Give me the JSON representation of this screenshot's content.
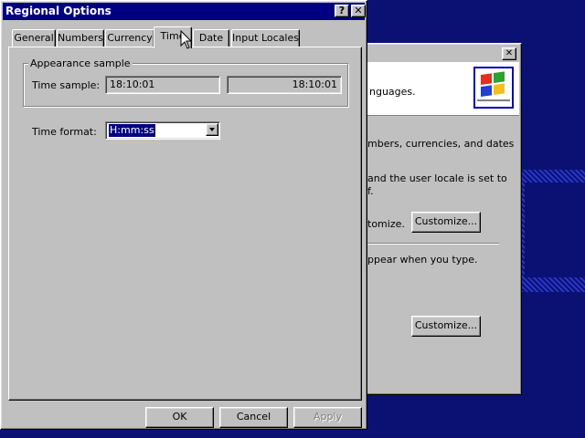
{
  "main_dialog": {
    "title": "Regional Options",
    "help_label": "?",
    "close_label": "✕",
    "tabs": [
      {
        "label": "General"
      },
      {
        "label": "Numbers"
      },
      {
        "label": "Currency"
      },
      {
        "label": "Time"
      },
      {
        "label": "Date"
      },
      {
        "label": "Input Locales"
      }
    ],
    "active_tab": "Time",
    "appearance": {
      "group_label": "Appearance sample",
      "time_sample_label": "Time sample:",
      "time_sample_value": "18:10:01",
      "time_sample_value_2": "18:10:01"
    },
    "time_format": {
      "label": "Time format:",
      "value": "H:mm:ss"
    },
    "buttons": {
      "ok": "OK",
      "cancel": "Cancel",
      "apply": "Apply"
    }
  },
  "background_dialog": {
    "close_label": "✕",
    "header_text": "nguages.",
    "line1": "mbers, currencies, and dates",
    "line2a": "and the user locale is set to",
    "line2b": "f.",
    "line3": "tomize.",
    "customize_label_1": "Customize...",
    "line4": "ppear when you type.",
    "customize_label_2": "Customize..."
  },
  "colors": {
    "desktop": "#0a1172",
    "titlebar_active": "#000080",
    "face": "#c0c0c0",
    "selection": "#000080"
  },
  "icons": {
    "cursor": "arrow-cursor-icon",
    "flag": "windows-flag-icon",
    "dropdown": "dropdown-arrow-icon"
  }
}
